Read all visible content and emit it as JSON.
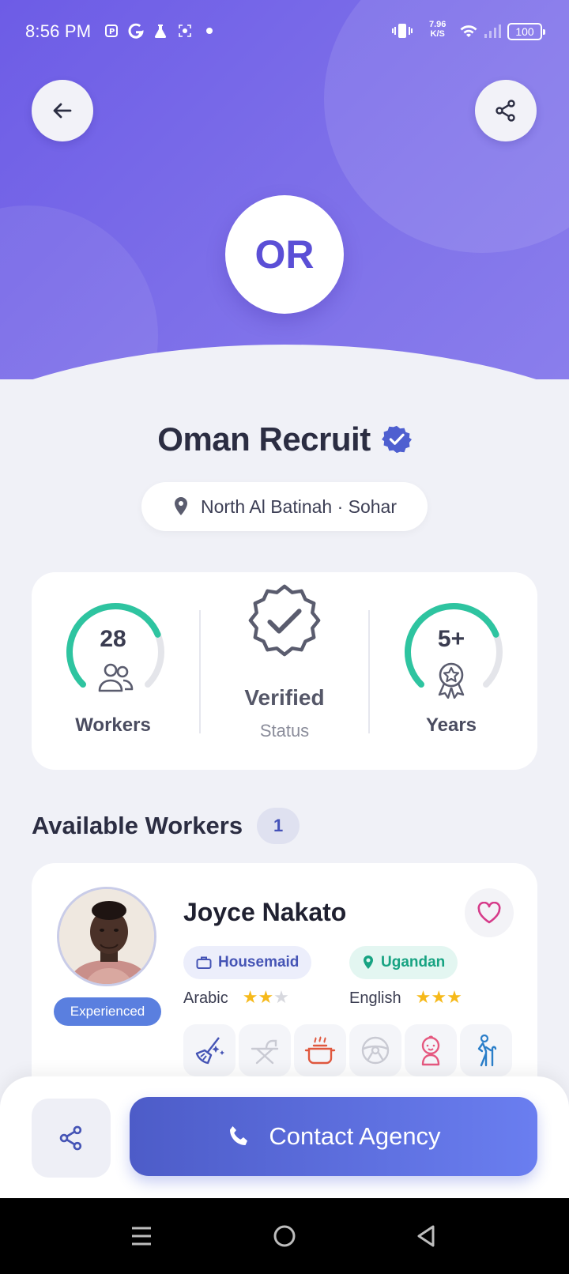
{
  "status_bar": {
    "time": "8:56 PM",
    "net_speed_value": "7.96",
    "net_speed_unit": "K/S",
    "battery": "100"
  },
  "agency": {
    "initials": "OR",
    "name": "Oman Recruit",
    "location": "North Al Batinah · Sohar"
  },
  "stats": {
    "workers_value": "28",
    "workers_label": "Workers",
    "workers_gauge_fraction": 0.75,
    "verified_title": "Verified",
    "verified_sub": "Status",
    "years_value": "5+",
    "years_label": "Years",
    "years_gauge_fraction": 0.75
  },
  "section": {
    "title": "Available Workers",
    "count": "1"
  },
  "worker": {
    "name": "Joyce Nakato",
    "badge": "Experienced",
    "job": "Housemaid",
    "nationality": "Ugandan",
    "languages": [
      {
        "name": "Arabic",
        "rating": 2,
        "max": 3
      },
      {
        "name": "English",
        "rating": 3,
        "max": 3
      }
    ],
    "skills": [
      {
        "icon": "cleaning-icon",
        "active": true
      },
      {
        "icon": "ironing-icon",
        "active": false
      },
      {
        "icon": "cooking-icon",
        "active": true
      },
      {
        "icon": "driving-icon",
        "active": false
      },
      {
        "icon": "babysitting-icon",
        "active": true
      },
      {
        "icon": "elderly-care-icon",
        "active": true
      }
    ]
  },
  "actions": {
    "contact_label": "Contact Agency"
  },
  "colors": {
    "primary": "#6d5ce6",
    "accent_teal": "#2ec4a0",
    "star": "#f6b91a",
    "button": "#5a6ee0"
  }
}
